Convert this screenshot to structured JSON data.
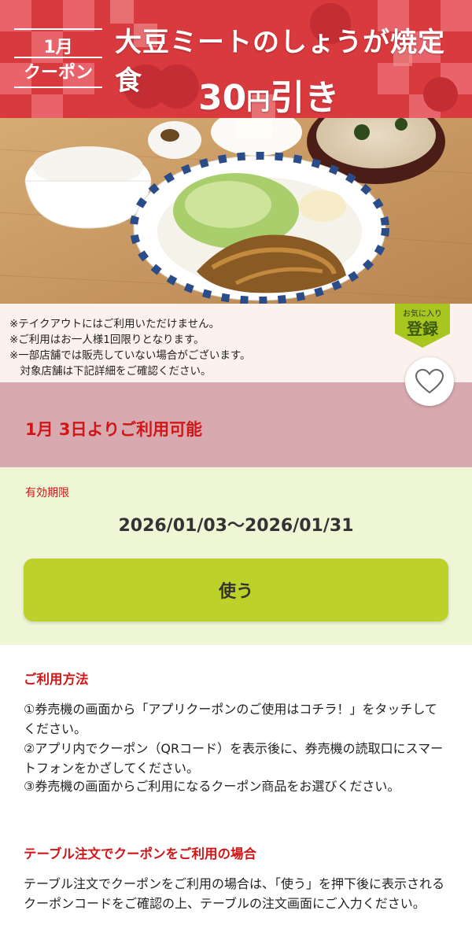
{
  "banner": {
    "month": "1月",
    "coupon_label": "クーポン",
    "title": "大豆ミートのしょうが焼定食",
    "discount_number": "30",
    "discount_yen": "円",
    "discount_suffix": "引き",
    "colors": {
      "primary": "#d83a3e",
      "secondary": "#e8646a",
      "accent": "#f29c9d"
    }
  },
  "photo": {
    "icon": "food-photo"
  },
  "notes": [
    "※テイクアウトにはご利用いただけません。",
    "※ご利用はお一人様1回限りとなります。",
    "※一部店舗では販売していない場合がございます。",
    "　対象店舗は下記詳細をご確認ください。"
  ],
  "favorite": {
    "small_label": "お気に入り",
    "big_label": "登録",
    "icon": "heart-icon"
  },
  "availability": {
    "text": "1月 3日よりご利用可能"
  },
  "validity": {
    "label": "有効期限",
    "dates": "2026/01/03～2026/01/31"
  },
  "use_button": {
    "label": "使う",
    "color": "#bcd12a"
  },
  "howto": {
    "heading": "ご利用方法",
    "steps": [
      "①券売機の画面から「アプリクーポンのご使用はコチラ！」をタッチしてください。",
      "②アプリ内でクーポン（QRコード）を表示後に、券売機の読取口にスマートフォンをかざしてください。",
      "③券売機の画面からご利用になるクーポン商品をお選びください。"
    ]
  },
  "table_order": {
    "heading": "テーブル注文でクーポンをご利用の場合",
    "text": "テーブル注文でクーポンをご利用の場合は、「使う」を押下後に表示されるクーポンコードをご確認の上、テーブルの注文画面にご入力ください。"
  }
}
